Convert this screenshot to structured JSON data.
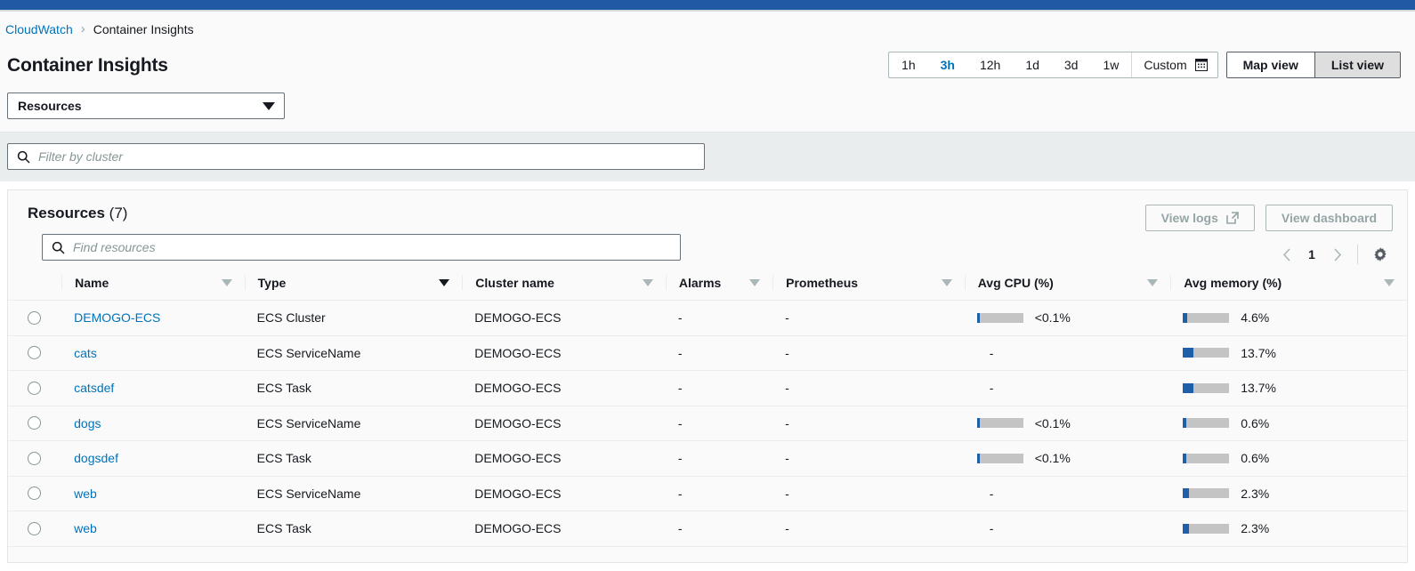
{
  "breadcrumb": {
    "root": "CloudWatch",
    "separator": "›",
    "current": "Container Insights"
  },
  "header": {
    "title": "Container Insights"
  },
  "time_range": {
    "options": [
      "1h",
      "3h",
      "12h",
      "1d",
      "3d",
      "1w"
    ],
    "selected": "3h",
    "custom_label": "Custom",
    "custom_icon": "calendar-icon"
  },
  "view_toggle": {
    "options": [
      "Map view",
      "List view"
    ],
    "selected": "List view"
  },
  "resource_select": {
    "value": "Resources",
    "icon": "chevron-down-icon"
  },
  "cluster_filter": {
    "placeholder": "Filter by cluster",
    "value": "",
    "icon": "search-icon"
  },
  "resources_panel": {
    "title": "Resources",
    "count": "(7)",
    "find_placeholder": "Find resources",
    "find_value": "",
    "find_icon": "search-icon",
    "view_logs_label": "View logs",
    "view_logs_icon": "external-link-icon",
    "view_dashboard_label": "View dashboard",
    "pagination": {
      "prev_icon": "chevron-left-icon",
      "page": "1",
      "next_icon": "chevron-right-icon",
      "settings_icon": "gear-icon"
    }
  },
  "table": {
    "columns": [
      {
        "label": "Name",
        "sorted": false
      },
      {
        "label": "Type",
        "sorted": true
      },
      {
        "label": "Cluster name",
        "sorted": false
      },
      {
        "label": "Alarms",
        "sorted": false
      },
      {
        "label": "Prometheus",
        "sorted": false
      },
      {
        "label": "Avg CPU (%)",
        "sorted": false
      },
      {
        "label": "Avg memory (%)",
        "sorted": false
      }
    ],
    "rows": [
      {
        "name": "DEMOGO-ECS",
        "type": "ECS Cluster",
        "cluster": "DEMOGO-ECS",
        "alarms": "-",
        "prometheus": "-",
        "cpu": {
          "value": "<0.1%",
          "pct": 7,
          "has_bar": true
        },
        "memory": {
          "value": "4.6%",
          "pct": 9,
          "has_bar": true
        }
      },
      {
        "name": "cats",
        "type": "ECS ServiceName",
        "cluster": "DEMOGO-ECS",
        "alarms": "-",
        "prometheus": "-",
        "cpu": {
          "value": "-",
          "pct": 0,
          "has_bar": false
        },
        "memory": {
          "value": "13.7%",
          "pct": 22,
          "has_bar": true
        }
      },
      {
        "name": "catsdef",
        "type": "ECS Task",
        "cluster": "DEMOGO-ECS",
        "alarms": "-",
        "prometheus": "-",
        "cpu": {
          "value": "-",
          "pct": 0,
          "has_bar": false
        },
        "memory": {
          "value": "13.7%",
          "pct": 22,
          "has_bar": true
        }
      },
      {
        "name": "dogs",
        "type": "ECS ServiceName",
        "cluster": "DEMOGO-ECS",
        "alarms": "-",
        "prometheus": "-",
        "cpu": {
          "value": "<0.1%",
          "pct": 7,
          "has_bar": true
        },
        "memory": {
          "value": "0.6%",
          "pct": 8,
          "has_bar": true
        }
      },
      {
        "name": "dogsdef",
        "type": "ECS Task",
        "cluster": "DEMOGO-ECS",
        "alarms": "-",
        "prometheus": "-",
        "cpu": {
          "value": "<0.1%",
          "pct": 7,
          "has_bar": true
        },
        "memory": {
          "value": "0.6%",
          "pct": 8,
          "has_bar": true
        }
      },
      {
        "name": "web",
        "type": "ECS ServiceName",
        "cluster": "DEMOGO-ECS",
        "alarms": "-",
        "prometheus": "-",
        "cpu": {
          "value": "-",
          "pct": 0,
          "has_bar": false
        },
        "memory": {
          "value": "2.3%",
          "pct": 12,
          "has_bar": true
        }
      },
      {
        "name": "web",
        "type": "ECS Task",
        "cluster": "DEMOGO-ECS",
        "alarms": "-",
        "prometheus": "-",
        "cpu": {
          "value": "-",
          "pct": 0,
          "has_bar": false
        },
        "memory": {
          "value": "2.3%",
          "pct": 12,
          "has_bar": true
        }
      }
    ]
  },
  "colors": {
    "brand_blue": "#2159a5",
    "link_blue": "#0073bb",
    "bar_fill": "#1f5faa",
    "bar_track": "#c4c4c4"
  }
}
